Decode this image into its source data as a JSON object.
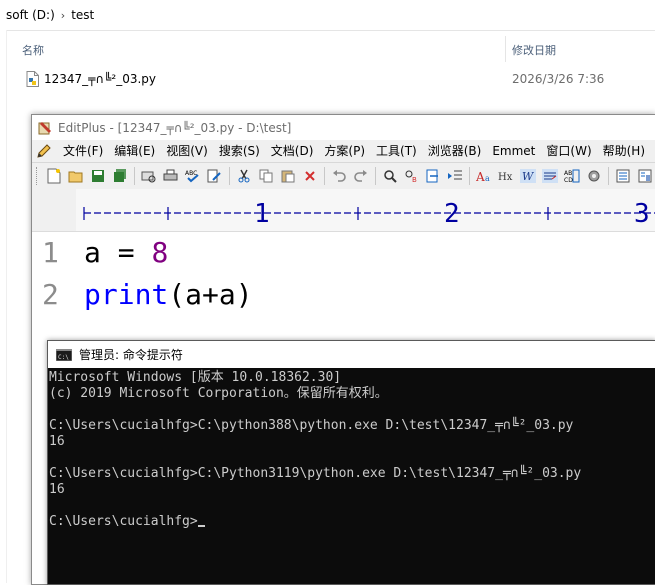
{
  "explorer": {
    "breadcrumb": [
      "soft (D:)",
      "test"
    ],
    "breadcrumb_separator": "›",
    "columns": {
      "name": "名称",
      "date": "修改日期"
    },
    "files": [
      {
        "name": "12347_╤∩╚²_03.py",
        "modified": "2026/3/26 7:36"
      }
    ]
  },
  "editplus": {
    "title": "EditPlus - [12347_╤∩╚²_03.py - D:\\test]",
    "menu": [
      "文件(F)",
      "编辑(E)",
      "视图(V)",
      "搜索(S)",
      "文档(D)",
      "方案(P)",
      "工具(T)",
      "浏览器(B)",
      "Emmet",
      "窗口(W)",
      "帮助(H)"
    ],
    "ruler": {
      "marks": [
        "1",
        "2",
        "3"
      ]
    },
    "lines": [
      {
        "number": "1",
        "parts": {
          "ident": "a",
          "op": " = ",
          "value": "8"
        }
      },
      {
        "number": "2",
        "parts": {
          "func": "print",
          "args": "(a+a)"
        }
      }
    ],
    "toolbar_icons": [
      "new-file-icon",
      "open-folder-icon",
      "save-icon",
      "save-all-icon",
      "print-preview-icon",
      "print-icon",
      "spellcheck-icon",
      "find-in-files-icon",
      "cut-icon",
      "copy-icon",
      "paste-icon",
      "delete-icon",
      "undo-icon",
      "redo-icon",
      "find-icon",
      "replace-icon",
      "goto-icon",
      "indent-icon",
      "font-icon",
      "hex-icon",
      "word-wrap-icon",
      "line-numbers-icon",
      "column-icon",
      "settings-icon",
      "document-view-icon",
      "split-view-icon"
    ]
  },
  "console": {
    "title": "管理员: 命令提示符",
    "lines": [
      "Microsoft Windows [版本 10.0.18362.30]",
      "(c) 2019 Microsoft Corporation。保留所有权利。",
      "",
      "C:\\Users\\cucialhfg>C:\\python388\\python.exe D:\\test\\12347_╤∩╚²_03.py",
      "16",
      "",
      "C:\\Users\\cucialhfg>C:\\Python3119\\python.exe D:\\test\\12347_╤∩╚²_03.py",
      "16",
      "",
      "C:\\Users\\cucialhfg>"
    ]
  },
  "colors": {
    "keyword": "#0000ff",
    "number": "#800080",
    "console_bg": "#0c0c0c",
    "console_text": "#cccccc",
    "ruler_blue": "#0000a0"
  }
}
